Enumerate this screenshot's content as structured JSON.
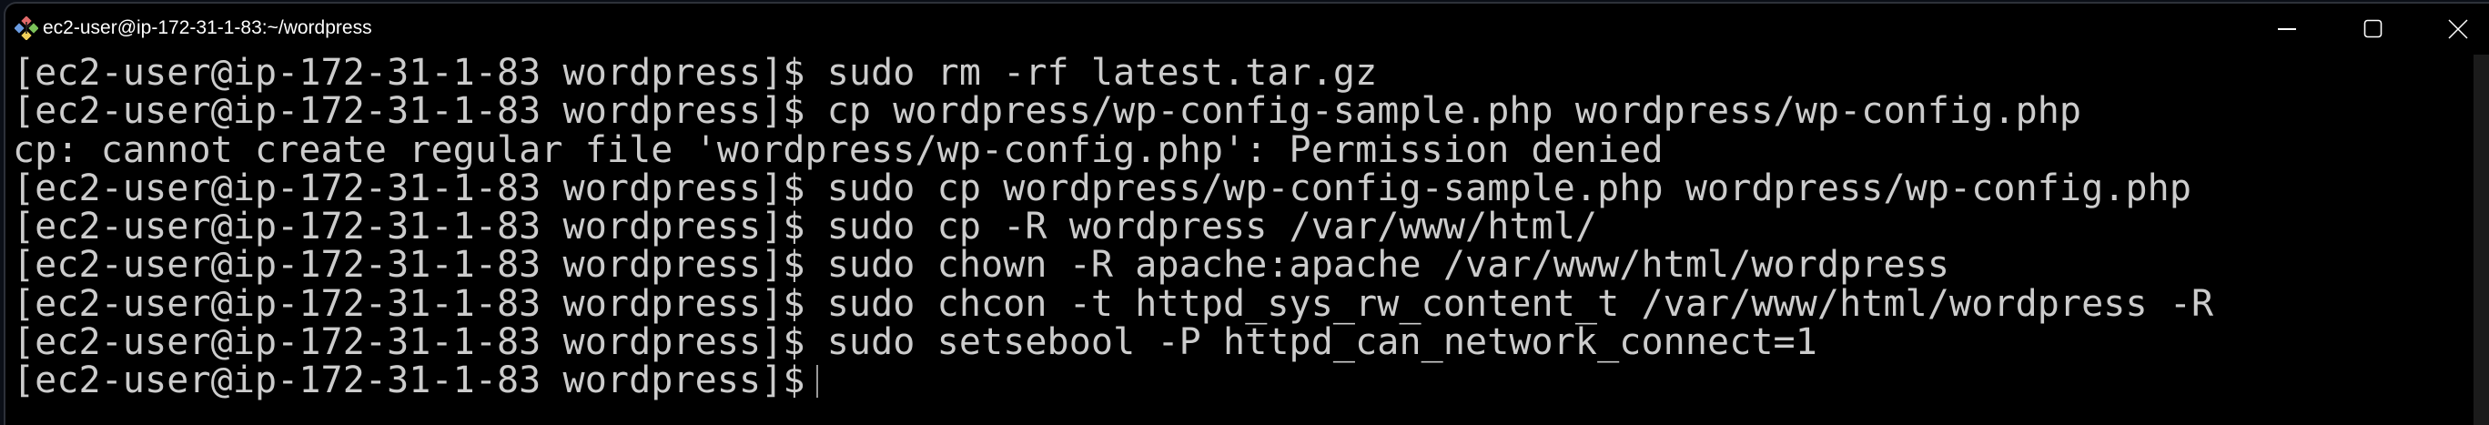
{
  "window": {
    "title": "ec2-user@ip-172-31-1-83:~/wordpress",
    "app_icon": "git-bash-diamond-icon",
    "controls": [
      "minimize-icon",
      "maximize-icon",
      "close-icon"
    ]
  },
  "terminal": {
    "lines": [
      "[ec2-user@ip-172-31-1-83 wordpress]$ sudo rm -rf latest.tar.gz",
      "[ec2-user@ip-172-31-1-83 wordpress]$ cp wordpress/wp-config-sample.php wordpress/wp-config.php",
      "cp: cannot create regular file 'wordpress/wp-config.php': Permission denied",
      "[ec2-user@ip-172-31-1-83 wordpress]$ sudo cp wordpress/wp-config-sample.php wordpress/wp-config.php",
      "[ec2-user@ip-172-31-1-83 wordpress]$ sudo cp -R wordpress /var/www/html/",
      "[ec2-user@ip-172-31-1-83 wordpress]$ sudo chown -R apache:apache /var/www/html/wordpress",
      "[ec2-user@ip-172-31-1-83 wordpress]$ sudo chcon -t httpd_sys_rw_content_t /var/www/html/wordpress -R",
      "[ec2-user@ip-172-31-1-83 wordpress]$ sudo setsebool -P httpd_can_network_connect=1"
    ],
    "prompt": "[ec2-user@ip-172-31-1-83 wordpress]$",
    "text_color": "#cccccc",
    "background": "#000000"
  }
}
